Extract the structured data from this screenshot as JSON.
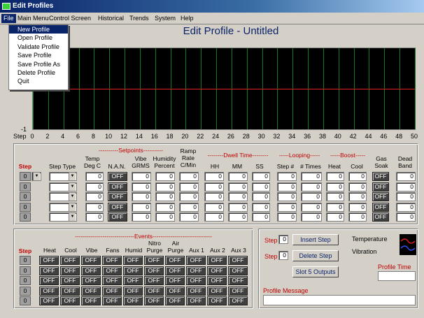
{
  "window": {
    "title": "Edit Profiles"
  },
  "menubar": [
    "File",
    "Main Menu",
    "Control Screen",
    "Historical",
    "Trends",
    "System",
    "Help"
  ],
  "file_menu": [
    "New Profile",
    "Open Profile",
    "Validate Profile",
    "Save Profile",
    "Save Profile As",
    "Delete Profile",
    "Quit"
  ],
  "page_title": "Edit Profile - Untitled",
  "plot": {
    "y_min_label": "-1",
    "x_axis_label": "Step",
    "x_ticks": [
      "0",
      "2",
      "4",
      "6",
      "8",
      "10",
      "12",
      "14",
      "16",
      "18",
      "20",
      "22",
      "24",
      "26",
      "28",
      "30",
      "32",
      "34",
      "36",
      "38",
      "40",
      "42",
      "44",
      "46",
      "48",
      "50"
    ],
    "line_color": "#e02020",
    "grid_color": "#0e7a20"
  },
  "steps": {
    "group_labels": {
      "setpoints": "Setpoints",
      "dwell": "Dwell Time",
      "looping": "Looping",
      "boost": "Boost"
    },
    "headers": {
      "step": "Step",
      "step_type": "Step Type",
      "temp": "Temp Deg C",
      "nan": "N.A.N.",
      "vibe": "Vibe GRMS",
      "humidity": "Humidity Percent",
      "ramp": "Ramp Rate C/Min",
      "hh": "HH",
      "mm": "MM",
      "ss": "SS",
      "step_num": "Step #",
      "times": "# Times",
      "heat": "Heat",
      "cool": "Cool",
      "gas": "Gas Soak",
      "dead": "Dead Band"
    },
    "step_numbers": [
      "0",
      "0",
      "0",
      "0",
      "0"
    ],
    "zero": "0",
    "off": "OFF"
  },
  "events": {
    "group_label": "Events",
    "step_header": "Step",
    "headers": [
      "Heat",
      "Cool",
      "Vibe",
      "Fans",
      "Humid",
      "Nitro Purge",
      "Air Purge",
      "Aux 1",
      "Aux 2",
      "Aux 3"
    ],
    "step_numbers": [
      "0",
      "0",
      "0",
      "0",
      "0"
    ],
    "off": "OFF"
  },
  "controls": {
    "step_label": "Step",
    "step_value_1": "0",
    "step_value_2": "0",
    "insert_step": "Insert Step",
    "delete_step": "Delete Step",
    "slot_outputs": "Slot 5 Outputs",
    "legend_temperature": "Temperature",
    "legend_vibration": "Vibration",
    "profile_time_label": "Profile Time",
    "profile_message_label": "Profile Message"
  }
}
